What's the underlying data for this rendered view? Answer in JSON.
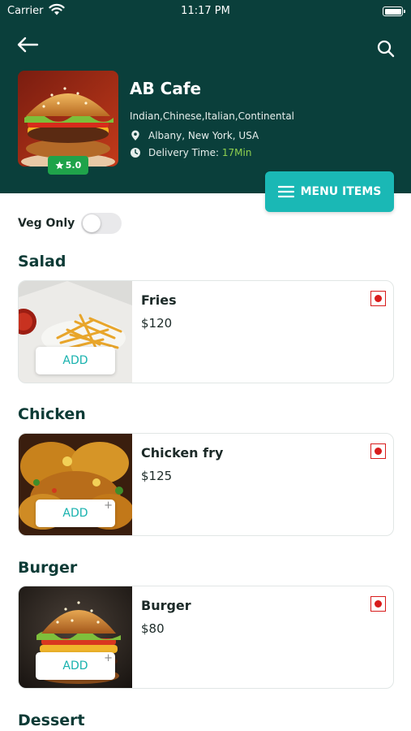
{
  "status_bar": {
    "carrier": "Carrier",
    "time": "11:17 PM"
  },
  "restaurant": {
    "name": "AB Cafe",
    "cuisines": "Indian,Chinese,Italian,Continental",
    "location": "Albany, New York, USA",
    "delivery_label": "Delivery Time: ",
    "delivery_time": "17Min",
    "rating": "5.0"
  },
  "menu_button": {
    "label": "MENU ITEMS"
  },
  "veg_filter": {
    "label": "Veg Only",
    "enabled": false
  },
  "sections": [
    {
      "title": "Salad",
      "items": [
        {
          "name": "Fries",
          "price": "$120",
          "add_label": "ADD",
          "customizable": false
        }
      ]
    },
    {
      "title": "Chicken",
      "items": [
        {
          "name": "Chicken fry",
          "price": "$125",
          "add_label": "ADD",
          "customizable": true
        }
      ]
    },
    {
      "title": "Burger",
      "items": [
        {
          "name": "Burger",
          "price": "$80",
          "add_label": "ADD",
          "customizable": true
        }
      ]
    },
    {
      "title": "Dessert",
      "items": []
    }
  ],
  "icons": {
    "back": "arrow-left-icon",
    "search": "search-icon",
    "location": "location-pin-icon",
    "clock": "clock-icon",
    "star": "star-icon",
    "menu": "hamburger-menu-icon",
    "non_veg": "non-veg-indicator-icon"
  },
  "colors": {
    "header_bg": "#0a3f3b",
    "accent_teal": "#1ab8b5",
    "rating_green": "#1fa34a",
    "delivery_time_green": "#8fd14f",
    "non_veg_red": "#d81c1c"
  }
}
